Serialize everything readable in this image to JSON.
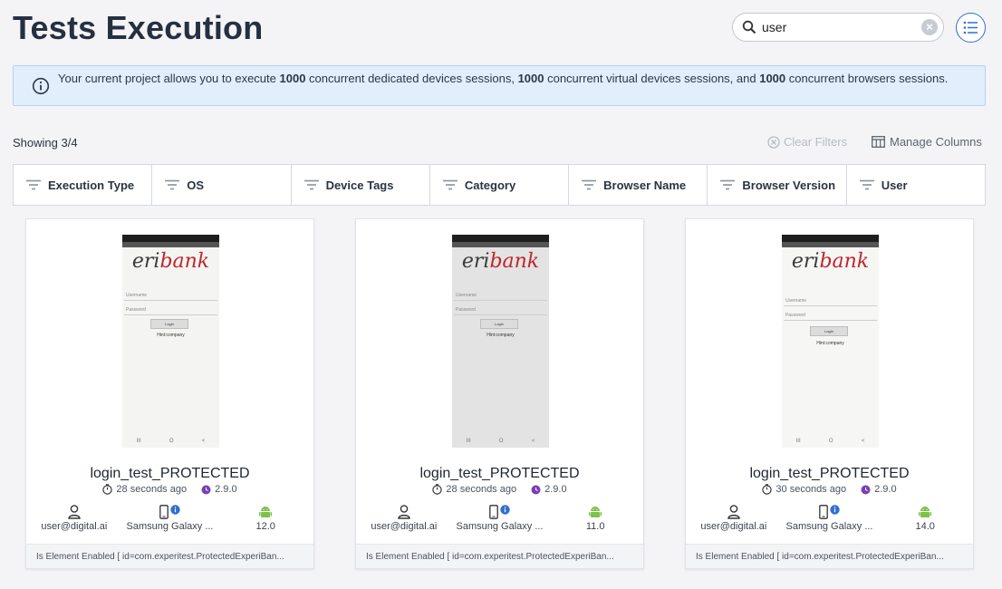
{
  "header": {
    "title": "Tests Execution"
  },
  "search": {
    "value": "user",
    "clear_label": "×"
  },
  "banner": {
    "text_1": "Your current project allows you to execute ",
    "dedicated": "1000",
    "text_2": " concurrent dedicated devices sessions, ",
    "virtual": "1000",
    "text_3": " concurrent virtual devices sessions, and ",
    "browsers": "1000",
    "text_4": " concurrent browsers sessions."
  },
  "toolbar": {
    "showing": "Showing 3/4",
    "clear_filters": "Clear Filters",
    "manage_columns": "Manage Columns"
  },
  "filters": [
    "Execution Type",
    "OS",
    "Device Tags",
    "Category",
    "Browser Name",
    "Browser Version",
    "User"
  ],
  "cards": [
    {
      "name": "login_test_PROTECTED",
      "time": "28 seconds ago",
      "version": "2.9.0",
      "user": "user@digital.ai",
      "device": "Samsung Galaxy ...",
      "os_version": "12.0",
      "footer": "Is Element Enabled [ id=com.experitest.ProtectedExperiBan..."
    },
    {
      "name": "login_test_PROTECTED",
      "time": "28 seconds ago",
      "version": "2.9.0",
      "user": "user@digital.ai",
      "device": "Samsung Galaxy ...",
      "os_version": "11.0",
      "footer": "Is Element Enabled [ id=com.experitest.ProtectedExperiBan..."
    },
    {
      "name": "login_test_PROTECTED",
      "time": "30 seconds ago",
      "version": "2.9.0",
      "user": "user@digital.ai",
      "device": "Samsung Galaxy ...",
      "os_version": "14.0",
      "footer": "Is Element Enabled [ id=com.experitest.ProtectedExperiBan..."
    }
  ],
  "phone": {
    "logo_a": "eri",
    "logo_b": "bank",
    "username": "Username",
    "password": "Password",
    "login": "Login",
    "hint": "Hint:company",
    "nav": [
      "III",
      "O",
      "<"
    ]
  },
  "colors": {
    "accent": "#2f6fd0",
    "banner_bg": "#e2eefc",
    "android": "#7cc24a",
    "version_dot": "#7b3fb5"
  },
  "icons": {
    "search": "search-icon",
    "clear": "clear-icon",
    "list": "list-view-icon",
    "info": "info-icon",
    "clear_filters": "clear-circle-icon",
    "manage_columns": "columns-icon",
    "filter": "filter-icon",
    "clock": "clock-icon",
    "version": "version-icon",
    "user": "user-icon",
    "device": "phone-icon",
    "os": "android-icon"
  }
}
